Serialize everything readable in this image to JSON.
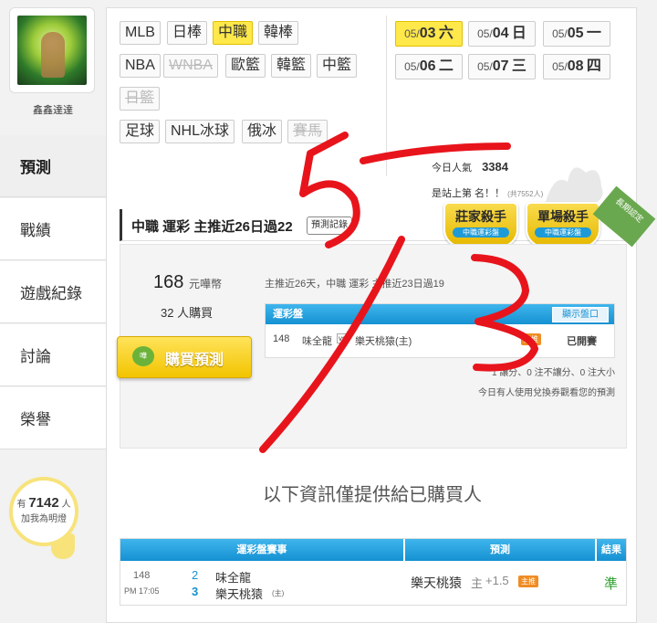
{
  "user": {
    "name": "鑫鑫達達"
  },
  "nav": [
    {
      "label": "預測",
      "active": true
    },
    {
      "label": "戰績"
    },
    {
      "label": "遊戲紀錄"
    },
    {
      "label": "討論"
    },
    {
      "label": "榮譽"
    }
  ],
  "fans": {
    "prefix": "有",
    "count": "7142",
    "suffix": "人",
    "line2": "加我為明燈"
  },
  "sports": {
    "row1": [
      "MLB",
      "日棒",
      "中職",
      "韓棒"
    ],
    "row2": [
      "NBA",
      "WNBA",
      "歐籃",
      "韓籃",
      "中籃"
    ],
    "row3": [
      "日籃"
    ],
    "row4": [
      "足球",
      "NHL冰球",
      "俄冰",
      "賽馬"
    ]
  },
  "dates": [
    {
      "md": "05/",
      "d": "03",
      "wd": "六"
    },
    {
      "md": "05/",
      "d": "04",
      "wd": "日"
    },
    {
      "md": "05/",
      "d": "05",
      "wd": "一"
    },
    {
      "md": "05/",
      "d": "06",
      "wd": "二"
    },
    {
      "md": "05/",
      "d": "07",
      "wd": "三"
    },
    {
      "md": "05/",
      "d": "08",
      "wd": "四"
    }
  ],
  "stats": {
    "today_label": "今日人氣",
    "today_value": "3384",
    "rank_text": "是站上第 名！！",
    "rank_sub": "(共7552人)"
  },
  "prediction": {
    "title": "中職 運彩 主推近26日過22",
    "record_button": "預測記錄",
    "badge1_title": "莊家殺手",
    "badge1_sub": "中職運彩盤",
    "badge2_title": "單場殺手",
    "badge2_sub": "中職運彩盤",
    "ribbon": "長期認定",
    "price": "168",
    "price_unit": "元嘩幣",
    "buyers": "32 人購買",
    "buy_button": "購買預測",
    "coin_label": "嘩",
    "summary": "主推近26天，中職 運彩 主推近23日過19",
    "table_title": "運彩盤",
    "odds_button": "顯示盤口",
    "game_no": "148",
    "team_a": "味全龍",
    "vs": "vs",
    "team_b": "樂天桃猿(主)",
    "main_tag": "主推",
    "status": "已開賽",
    "rule1": "1 讓分、0 注不讓分、0 注大小",
    "rule2": "今日有人使用兌換券觀看您的預測"
  },
  "notice": "以下資訊僅提供給已購買人",
  "results": {
    "headers": [
      "運彩盤賽事",
      "預測",
      "結果"
    ],
    "row": {
      "game_no": "148",
      "time": "PM 17:05",
      "score_a": "2",
      "score_b": "3",
      "team_a": "味全龍",
      "team_b": "樂天桃猿",
      "home_tag": "(主)",
      "pick_team": "樂天桃猿",
      "pick_tag": "主",
      "pick_line": "+1.5",
      "pick_badge": "主推",
      "result": "準"
    }
  },
  "overlay_note": "5/3",
  "colors": {
    "accent_yellow": "#ffe84a",
    "header_blue": "#1591d2",
    "result_green": "#2a9d2a",
    "stroke_red": "#e8141c"
  }
}
